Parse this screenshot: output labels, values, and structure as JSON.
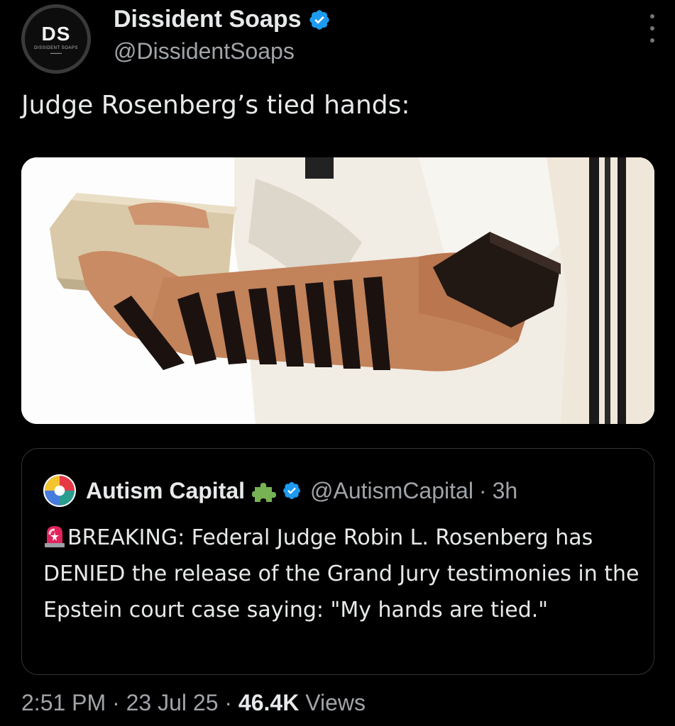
{
  "author": {
    "display_name": "Dissident Soaps",
    "handle": "@DissidentSoaps",
    "avatar_text": "DS",
    "avatar_subtext": "DISSIDENT SOAPS",
    "verified": true
  },
  "tweet": {
    "text": "Judge Rosenberg’s tied hands:",
    "media_icon": "photo-arm-wrapped-leather-straps"
  },
  "quoted_tweet": {
    "display_name": "Autism Capital",
    "name_emoji": "puzzle-icon",
    "verified": true,
    "handle": "@AutismCapital",
    "separator": "·",
    "time_ago": "3h",
    "prefix_icon": "siren-icon",
    "body": "BREAKING: Federal Judge Robin L. Rosenberg has DENIED the release of the Grand Jury testimonies in the Epstein court case saying: \"My hands are tied.\""
  },
  "meta": {
    "time": "2:51 PM",
    "sep1": "·",
    "date": "23 Jul 25",
    "sep2": "·",
    "views_count": "46.4K",
    "views_label": "Views"
  },
  "colors": {
    "background": "#000000",
    "text_primary": "#e7e9ea",
    "text_secondary": "#a0a4a8",
    "verified_blue": "#1d9bf0",
    "border": "#2f3336"
  }
}
